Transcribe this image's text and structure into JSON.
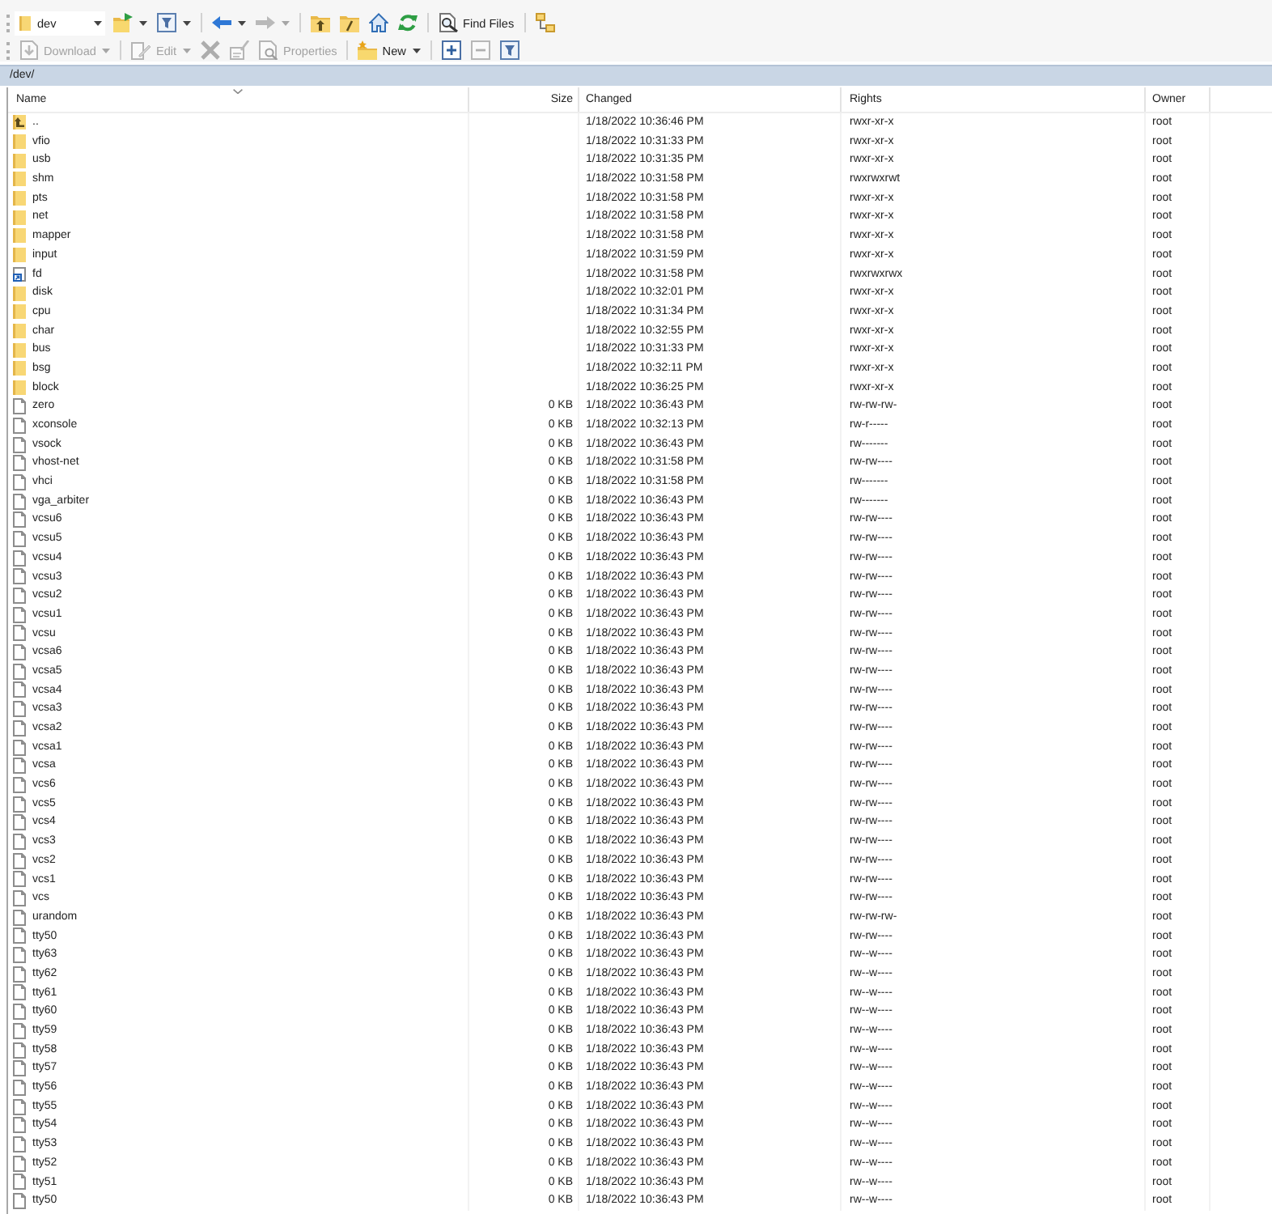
{
  "toolbars": [
    {
      "items": [
        {
          "kind": "location",
          "value": "dev"
        },
        {
          "kind": "icon",
          "disabled": false,
          "menu": true
        },
        {
          "kind": "icon",
          "disabled": false,
          "menu": true
        },
        {
          "kind": "separator"
        },
        {
          "kind": "icon",
          "disabled": false,
          "menu": true
        },
        {
          "kind": "icon",
          "disabled": true,
          "menu": true
        },
        {
          "kind": "separator"
        },
        {
          "kind": "icon",
          "disabled": false,
          "menu": false
        },
        {
          "kind": "icon",
          "disabled": false,
          "menu": false
        },
        {
          "kind": "icon",
          "disabled": false,
          "menu": false
        },
        {
          "kind": "icon",
          "disabled": false,
          "menu": false
        },
        {
          "kind": "separator"
        },
        {
          "kind": "button",
          "label": "Find Files",
          "disabled": false,
          "menu": false
        },
        {
          "kind": "separator"
        },
        {
          "kind": "icon",
          "disabled": false,
          "menu": false
        }
      ]
    },
    {
      "items": [
        {
          "kind": "button",
          "label": "Download",
          "disabled": true,
          "menu": true
        },
        {
          "kind": "separator"
        },
        {
          "kind": "button",
          "label": "Edit",
          "disabled": true,
          "menu": true
        },
        {
          "kind": "icon",
          "disabled": true,
          "menu": false
        },
        {
          "kind": "icon",
          "disabled": true,
          "menu": false
        },
        {
          "kind": "button",
          "label": "Properties",
          "disabled": true,
          "menu": false
        },
        {
          "kind": "separator"
        },
        {
          "kind": "button",
          "label": "New",
          "disabled": false,
          "menu": true
        },
        {
          "kind": "separator"
        },
        {
          "kind": "icon",
          "disabled": false,
          "menu": false
        },
        {
          "kind": "icon",
          "disabled": true,
          "menu": false
        },
        {
          "kind": "icon",
          "disabled": false,
          "menu": false
        }
      ]
    }
  ],
  "path_bar": {
    "path": "/dev/"
  },
  "file_list": {
    "columns": [
      {
        "label": "Name",
        "sorted": true
      },
      {
        "label": "Size",
        "sorted": false
      },
      {
        "label": "Changed",
        "sorted": false
      },
      {
        "label": "Rights",
        "sorted": false
      },
      {
        "label": "Owner",
        "sorted": false
      }
    ],
    "rows": [
      {
        "kind": "parent",
        "name": "..",
        "changed": "1/18/2022 10:36:46 PM",
        "rights": "rwxr-xr-x",
        "owner": "root"
      },
      {
        "kind": "folder",
        "name": "vfio",
        "changed": "1/18/2022 10:31:33 PM",
        "rights": "rwxr-xr-x",
        "owner": "root"
      },
      {
        "kind": "folder",
        "name": "usb",
        "changed": "1/18/2022 10:31:35 PM",
        "rights": "rwxr-xr-x",
        "owner": "root"
      },
      {
        "kind": "folder",
        "name": "shm",
        "changed": "1/18/2022 10:31:58 PM",
        "rights": "rwxrwxrwt",
        "owner": "root"
      },
      {
        "kind": "folder",
        "name": "pts",
        "changed": "1/18/2022 10:31:58 PM",
        "rights": "rwxr-xr-x",
        "owner": "root"
      },
      {
        "kind": "folder",
        "name": "net",
        "changed": "1/18/2022 10:31:58 PM",
        "rights": "rwxr-xr-x",
        "owner": "root"
      },
      {
        "kind": "folder",
        "name": "mapper",
        "changed": "1/18/2022 10:31:58 PM",
        "rights": "rwxr-xr-x",
        "owner": "root"
      },
      {
        "kind": "folder",
        "name": "input",
        "changed": "1/18/2022 10:31:59 PM",
        "rights": "rwxr-xr-x",
        "owner": "root"
      },
      {
        "kind": "link",
        "name": "fd",
        "changed": "1/18/2022 10:31:58 PM",
        "rights": "rwxrwxrwx",
        "owner": "root"
      },
      {
        "kind": "folder",
        "name": "disk",
        "changed": "1/18/2022 10:32:01 PM",
        "rights": "rwxr-xr-x",
        "owner": "root"
      },
      {
        "kind": "folder",
        "name": "cpu",
        "changed": "1/18/2022 10:31:34 PM",
        "rights": "rwxr-xr-x",
        "owner": "root"
      },
      {
        "kind": "folder",
        "name": "char",
        "changed": "1/18/2022 10:32:55 PM",
        "rights": "rwxr-xr-x",
        "owner": "root"
      },
      {
        "kind": "folder",
        "name": "bus",
        "changed": "1/18/2022 10:31:33 PM",
        "rights": "rwxr-xr-x",
        "owner": "root"
      },
      {
        "kind": "folder",
        "name": "bsg",
        "changed": "1/18/2022 10:32:11 PM",
        "rights": "rwxr-xr-x",
        "owner": "root"
      },
      {
        "kind": "folder",
        "name": "block",
        "changed": "1/18/2022 10:36:25 PM",
        "rights": "rwxr-xr-x",
        "owner": "root"
      },
      {
        "kind": "file",
        "name": "zero",
        "size": "0 KB",
        "changed": "1/18/2022 10:36:43 PM",
        "rights": "rw-rw-rw-",
        "owner": "root"
      },
      {
        "kind": "file",
        "name": "xconsole",
        "size": "0 KB",
        "changed": "1/18/2022 10:32:13 PM",
        "rights": "rw-r-----",
        "owner": "root"
      },
      {
        "kind": "file",
        "name": "vsock",
        "size": "0 KB",
        "changed": "1/18/2022 10:36:43 PM",
        "rights": "rw-------",
        "owner": "root"
      },
      {
        "kind": "file",
        "name": "vhost-net",
        "size": "0 KB",
        "changed": "1/18/2022 10:31:58 PM",
        "rights": "rw-rw----",
        "owner": "root"
      },
      {
        "kind": "file",
        "name": "vhci",
        "size": "0 KB",
        "changed": "1/18/2022 10:31:58 PM",
        "rights": "rw-------",
        "owner": "root"
      },
      {
        "kind": "file",
        "name": "vga_arbiter",
        "size": "0 KB",
        "changed": "1/18/2022 10:36:43 PM",
        "rights": "rw-------",
        "owner": "root"
      },
      {
        "kind": "file",
        "name": "vcsu6",
        "size": "0 KB",
        "changed": "1/18/2022 10:36:43 PM",
        "rights": "rw-rw----",
        "owner": "root"
      },
      {
        "kind": "file",
        "name": "vcsu5",
        "size": "0 KB",
        "changed": "1/18/2022 10:36:43 PM",
        "rights": "rw-rw----",
        "owner": "root"
      },
      {
        "kind": "file",
        "name": "vcsu4",
        "size": "0 KB",
        "changed": "1/18/2022 10:36:43 PM",
        "rights": "rw-rw----",
        "owner": "root"
      },
      {
        "kind": "file",
        "name": "vcsu3",
        "size": "0 KB",
        "changed": "1/18/2022 10:36:43 PM",
        "rights": "rw-rw----",
        "owner": "root"
      },
      {
        "kind": "file",
        "name": "vcsu2",
        "size": "0 KB",
        "changed": "1/18/2022 10:36:43 PM",
        "rights": "rw-rw----",
        "owner": "root"
      },
      {
        "kind": "file",
        "name": "vcsu1",
        "size": "0 KB",
        "changed": "1/18/2022 10:36:43 PM",
        "rights": "rw-rw----",
        "owner": "root"
      },
      {
        "kind": "file",
        "name": "vcsu",
        "size": "0 KB",
        "changed": "1/18/2022 10:36:43 PM",
        "rights": "rw-rw----",
        "owner": "root"
      },
      {
        "kind": "file",
        "name": "vcsa6",
        "size": "0 KB",
        "changed": "1/18/2022 10:36:43 PM",
        "rights": "rw-rw----",
        "owner": "root"
      },
      {
        "kind": "file",
        "name": "vcsa5",
        "size": "0 KB",
        "changed": "1/18/2022 10:36:43 PM",
        "rights": "rw-rw----",
        "owner": "root"
      },
      {
        "kind": "file",
        "name": "vcsa4",
        "size": "0 KB",
        "changed": "1/18/2022 10:36:43 PM",
        "rights": "rw-rw----",
        "owner": "root"
      },
      {
        "kind": "file",
        "name": "vcsa3",
        "size": "0 KB",
        "changed": "1/18/2022 10:36:43 PM",
        "rights": "rw-rw----",
        "owner": "root"
      },
      {
        "kind": "file",
        "name": "vcsa2",
        "size": "0 KB",
        "changed": "1/18/2022 10:36:43 PM",
        "rights": "rw-rw----",
        "owner": "root"
      },
      {
        "kind": "file",
        "name": "vcsa1",
        "size": "0 KB",
        "changed": "1/18/2022 10:36:43 PM",
        "rights": "rw-rw----",
        "owner": "root"
      },
      {
        "kind": "file",
        "name": "vcsa",
        "size": "0 KB",
        "changed": "1/18/2022 10:36:43 PM",
        "rights": "rw-rw----",
        "owner": "root"
      },
      {
        "kind": "file",
        "name": "vcs6",
        "size": "0 KB",
        "changed": "1/18/2022 10:36:43 PM",
        "rights": "rw-rw----",
        "owner": "root"
      },
      {
        "kind": "file",
        "name": "vcs5",
        "size": "0 KB",
        "changed": "1/18/2022 10:36:43 PM",
        "rights": "rw-rw----",
        "owner": "root"
      },
      {
        "kind": "file",
        "name": "vcs4",
        "size": "0 KB",
        "changed": "1/18/2022 10:36:43 PM",
        "rights": "rw-rw----",
        "owner": "root"
      },
      {
        "kind": "file",
        "name": "vcs3",
        "size": "0 KB",
        "changed": "1/18/2022 10:36:43 PM",
        "rights": "rw-rw----",
        "owner": "root"
      },
      {
        "kind": "file",
        "name": "vcs2",
        "size": "0 KB",
        "changed": "1/18/2022 10:36:43 PM",
        "rights": "rw-rw----",
        "owner": "root"
      },
      {
        "kind": "file",
        "name": "vcs1",
        "size": "0 KB",
        "changed": "1/18/2022 10:36:43 PM",
        "rights": "rw-rw----",
        "owner": "root"
      },
      {
        "kind": "file",
        "name": "vcs",
        "size": "0 KB",
        "changed": "1/18/2022 10:36:43 PM",
        "rights": "rw-rw----",
        "owner": "root"
      },
      {
        "kind": "file",
        "name": "urandom",
        "size": "0 KB",
        "changed": "1/18/2022 10:36:43 PM",
        "rights": "rw-rw-rw-",
        "owner": "root"
      },
      {
        "kind": "file",
        "name": "tty50",
        "size": "0 KB",
        "changed": "1/18/2022 10:36:43 PM",
        "rights": "rw-rw----",
        "owner": "root"
      },
      {
        "kind": "file",
        "name": "tty63",
        "size": "0 KB",
        "changed": "1/18/2022 10:36:43 PM",
        "rights": "rw--w----",
        "owner": "root"
      },
      {
        "kind": "file",
        "name": "tty62",
        "size": "0 KB",
        "changed": "1/18/2022 10:36:43 PM",
        "rights": "rw--w----",
        "owner": "root"
      },
      {
        "kind": "file",
        "name": "tty61",
        "size": "0 KB",
        "changed": "1/18/2022 10:36:43 PM",
        "rights": "rw--w----",
        "owner": "root"
      },
      {
        "kind": "file",
        "name": "tty60",
        "size": "0 KB",
        "changed": "1/18/2022 10:36:43 PM",
        "rights": "rw--w----",
        "owner": "root"
      },
      {
        "kind": "file",
        "name": "tty59",
        "size": "0 KB",
        "changed": "1/18/2022 10:36:43 PM",
        "rights": "rw--w----",
        "owner": "root"
      },
      {
        "kind": "file",
        "name": "tty58",
        "size": "0 KB",
        "changed": "1/18/2022 10:36:43 PM",
        "rights": "rw--w----",
        "owner": "root"
      },
      {
        "kind": "file",
        "name": "tty57",
        "size": "0 KB",
        "changed": "1/18/2022 10:36:43 PM",
        "rights": "rw--w----",
        "owner": "root"
      },
      {
        "kind": "file",
        "name": "tty56",
        "size": "0 KB",
        "changed": "1/18/2022 10:36:43 PM",
        "rights": "rw--w----",
        "owner": "root"
      },
      {
        "kind": "file",
        "name": "tty55",
        "size": "0 KB",
        "changed": "1/18/2022 10:36:43 PM",
        "rights": "rw--w----",
        "owner": "root"
      },
      {
        "kind": "file",
        "name": "tty54",
        "size": "0 KB",
        "changed": "1/18/2022 10:36:43 PM",
        "rights": "rw--w----",
        "owner": "root"
      },
      {
        "kind": "file",
        "name": "tty53",
        "size": "0 KB",
        "changed": "1/18/2022 10:36:43 PM",
        "rights": "rw--w----",
        "owner": "root"
      },
      {
        "kind": "file",
        "name": "tty52",
        "size": "0 KB",
        "changed": "1/18/2022 10:36:43 PM",
        "rights": "rw--w----",
        "owner": "root"
      },
      {
        "kind": "file",
        "name": "tty51",
        "size": "0 KB",
        "changed": "1/18/2022 10:36:43 PM",
        "rights": "rw--w----",
        "owner": "root"
      },
      {
        "kind": "file",
        "name": "tty50",
        "size": "0 KB",
        "changed": "1/18/2022 10:36:43 PM",
        "rights": "rw--w----",
        "owner": "root"
      }
    ]
  }
}
